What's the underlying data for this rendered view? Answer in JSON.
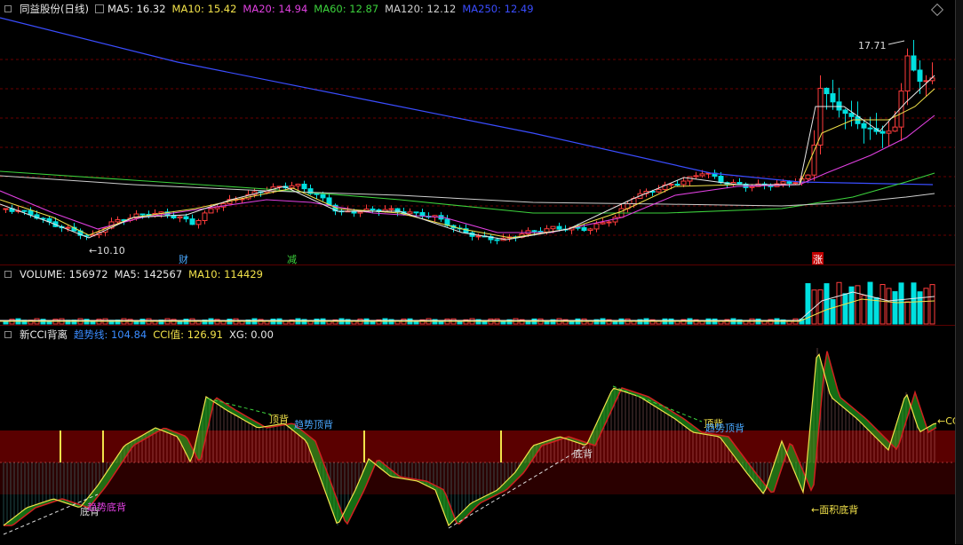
{
  "main": {
    "title": "同益股份(日线)",
    "ma": [
      {
        "label": "MA5: 16.32",
        "color": "#e8e8e8"
      },
      {
        "label": "MA10: 15.42",
        "color": "#f2e24a"
      },
      {
        "label": "MA20: 14.94",
        "color": "#e040e0"
      },
      {
        "label": "MA60: 12.87",
        "color": "#3cd23c"
      },
      {
        "label": "MA120: 12.12",
        "color": "#cfcfcf"
      },
      {
        "label": "MA250: 12.49",
        "color": "#3a4dff"
      }
    ],
    "high_label": "17.71",
    "low_label": "←10.10",
    "markers": [
      {
        "text": "财",
        "color": "#4aa8ff"
      },
      {
        "text": "减",
        "color": "#3cd23c"
      },
      {
        "text": "涨",
        "color": "#ffffff",
        "bg": "#c00000"
      }
    ]
  },
  "volume": {
    "title": "VOLUME: 156972",
    "ma5": "MA5: 142567",
    "ma10": "MA10: 114429"
  },
  "cci": {
    "title": "新CCI背离",
    "trend": "趋势线: 104.84",
    "value": "CCI值: 126.91",
    "xg": "XG: 0.00",
    "annotations": {
      "top_div_1": "顶背",
      "trend_top_1": "趋势顶背",
      "top_div_2": "顶背",
      "trend_top_2": "趋势顶背",
      "bottom_div_1": "底背",
      "trend_bottom": "趋势底背",
      "bottom_div_2": "底背",
      "area_bottom": "←面积底背",
      "right_edge": "←CC"
    }
  },
  "colors": {
    "up": "#ff3c3c",
    "down": "#00e0e0",
    "grid": "#6a0000",
    "band": "#5a0000"
  }
}
